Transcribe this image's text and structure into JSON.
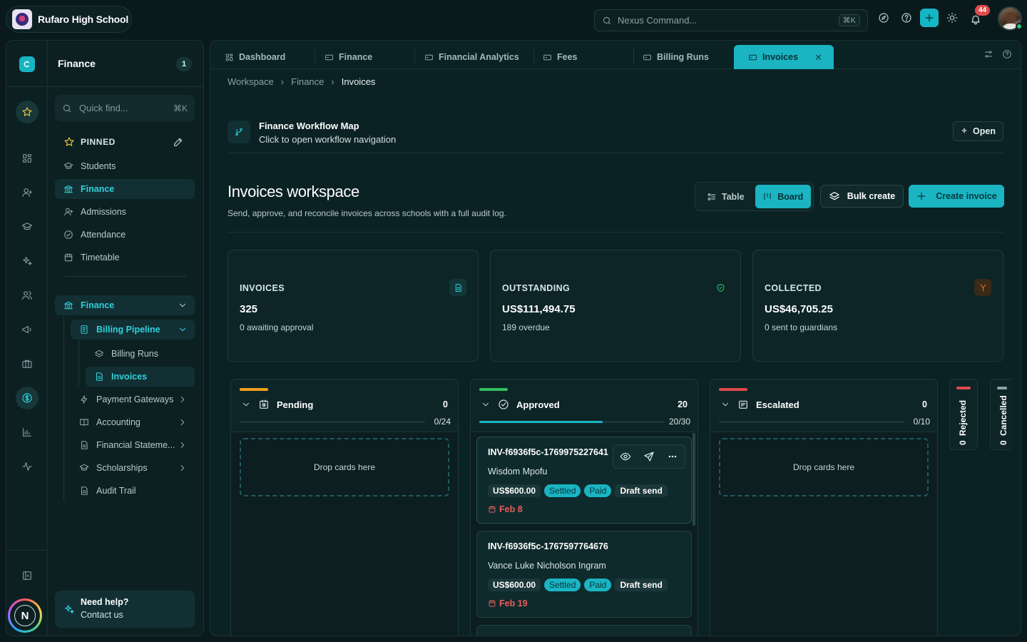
{
  "topbar": {
    "school_name": "Rufaro High School",
    "command_placeholder": "Nexus Command...",
    "command_shortcut": "⌘K",
    "notifications_count": "44"
  },
  "rail": {
    "user_initial": "N"
  },
  "sidebar": {
    "title": "Finance",
    "count": "1",
    "quick_find_placeholder": "Quick find...",
    "quick_find_shortcut": "⌘K",
    "pinned_label": "PINNED",
    "pinned_items": [
      {
        "label": "Students",
        "icon": "graduation-cap-icon"
      },
      {
        "label": "Finance",
        "icon": "bank-icon"
      },
      {
        "label": "Admissions",
        "icon": "user-plus-icon"
      },
      {
        "label": "Attendance",
        "icon": "check-circle-icon"
      },
      {
        "label": "Timetable",
        "icon": "calendar-icon"
      }
    ],
    "section": {
      "label": "Finance",
      "group": "Billing Pipeline",
      "group_children": [
        "Billing Runs",
        "Invoices"
      ],
      "items": [
        {
          "label": "Payment Gateways",
          "icon": "bolt-icon"
        },
        {
          "label": "Accounting",
          "icon": "book-icon"
        },
        {
          "label": "Financial Stateme...",
          "icon": "document-icon"
        },
        {
          "label": "Scholarships",
          "icon": "graduation-cap-icon"
        },
        {
          "label": "Audit Trail",
          "icon": "document-icon"
        }
      ]
    },
    "help": {
      "title": "Need help?",
      "subtitle": "Contact us"
    }
  },
  "tabs": [
    {
      "label": "Dashboard",
      "icon": "grid-icon"
    },
    {
      "label": "Finance",
      "icon": "card-icon"
    },
    {
      "label": "Financial Analytics",
      "icon": "card-icon"
    },
    {
      "label": "Fees",
      "icon": "card-icon"
    },
    {
      "label": "Billing Runs",
      "icon": "card-icon"
    },
    {
      "label": "Invoices",
      "icon": "card-icon",
      "active": true
    }
  ],
  "breadcrumb": [
    "Workspace",
    "Finance",
    "Invoices"
  ],
  "workflow": {
    "title": "Finance Workflow Map",
    "subtitle": "Click to open workflow navigation",
    "open_label": "Open"
  },
  "workspace": {
    "title": "Invoices workspace",
    "subtitle": "Send, approve, and reconcile invoices across schools with a full audit log.",
    "view_table": "Table",
    "view_board": "Board",
    "active_view": "Board",
    "bulk_create": "Bulk create",
    "create_invoice": "Create invoice"
  },
  "stats": [
    {
      "label": "INVOICES",
      "value": "325",
      "sub": "0 awaiting approval",
      "icon": "document-icon",
      "color": "#2fd0dc"
    },
    {
      "label": "OUTSTANDING",
      "value": "US$111,494.75",
      "sub": "189 overdue",
      "icon": "shield-check-icon",
      "color": "#2fd06a"
    },
    {
      "label": "COLLECTED",
      "value": "US$46,705.25",
      "sub": "0 sent to guardians",
      "icon": "merge-icon",
      "color": "#ee7a2c"
    }
  ],
  "board": {
    "columns": [
      {
        "name": "Pending",
        "count": "0",
        "ratio": "0/24",
        "progress": 0,
        "color": "#f0a01e",
        "drop_label": "Drop cards here",
        "icon": "clock-icon"
      },
      {
        "name": "Approved",
        "count": "20",
        "ratio": "20/30",
        "progress": 0.667,
        "color": "#2fbf5a",
        "icon": "check-circle-icon",
        "cards": [
          {
            "id": "INV-f6936f5c-1769975227641",
            "name": "Wisdom Mpofu",
            "amount": "US$600.00",
            "tags": [
              "Settled",
              "Paid"
            ],
            "send": "Draft send",
            "due": "Feb 8"
          },
          {
            "id": "INV-f6936f5c-1767597764676",
            "name": "Vance Luke Nicholson Ingram",
            "amount": "US$600.00",
            "tags": [
              "Settled",
              "Paid"
            ],
            "send": "Draft send",
            "due": "Feb 19"
          }
        ]
      },
      {
        "name": "Escalated",
        "count": "0",
        "ratio": "0/10",
        "progress": 0,
        "color": "#e04a4a",
        "drop_label": "Drop cards here",
        "icon": "calendar-icon"
      }
    ],
    "collapsed": [
      {
        "name": "Rejected",
        "count": "0",
        "color": "#e04a4a"
      },
      {
        "name": "Cancelled",
        "count": "0",
        "color": "#8aa2a3"
      }
    ]
  }
}
